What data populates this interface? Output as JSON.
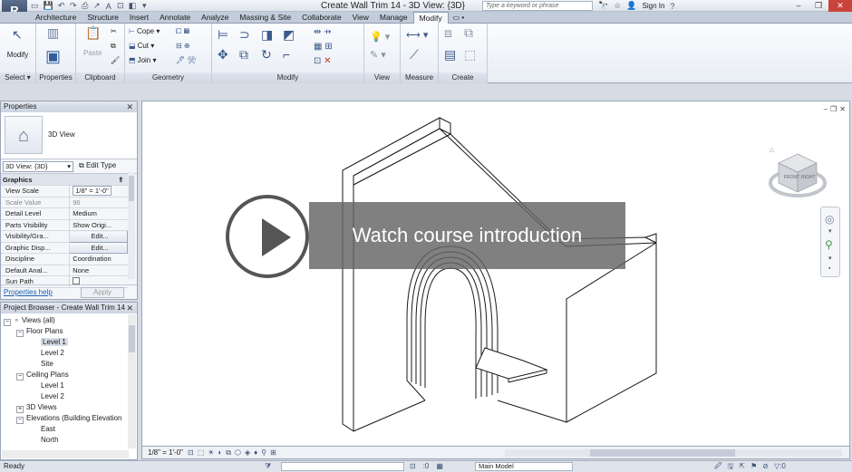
{
  "app": {
    "logo": "R",
    "quick_access": [
      "▭",
      "💾",
      "↶",
      "↷",
      "⎙",
      "↗",
      "A",
      "⊡",
      "◧",
      "▾"
    ],
    "title": "Create Wall Trim 14 - 3D View: {3D}",
    "search_placeholder": "Type a keyword or phrase",
    "title_icons": [
      "🔭",
      "☆",
      "👤"
    ],
    "sign_in": "Sign In",
    "help": "?",
    "window_buttons": [
      "–",
      "❐",
      "✕"
    ]
  },
  "ribbon": {
    "tabs": [
      "Architecture",
      "Structure",
      "Insert",
      "Annotate",
      "Analyze",
      "Massing & Site",
      "Collaborate",
      "View",
      "Manage",
      "Modify"
    ],
    "active_tab": "Modify",
    "tab_extra": "▭ •",
    "panels": {
      "select": {
        "label": "Select ▾",
        "button": "Modify"
      },
      "properties": {
        "label": "Properties"
      },
      "clipboard": {
        "label": "Clipboard",
        "button": "Paste"
      },
      "geometry": {
        "label": "Geometry",
        "cope": "Cope ▾",
        "cut": "Cut ▾",
        "join": "Join ▾"
      },
      "modify": {
        "label": "Modify"
      },
      "view": {
        "label": "View"
      },
      "measure": {
        "label": "Measure"
      },
      "create": {
        "label": "Create"
      }
    }
  },
  "properties": {
    "title": "Properties",
    "type_name": "3D View",
    "instance_select": "3D View: {3D}",
    "edit_type": "Edit Type",
    "group": "Graphics",
    "rows": [
      {
        "name": "View Scale",
        "value": "1/8\" = 1'-0\""
      },
      {
        "name": "Scale Value",
        "value": "96"
      },
      {
        "name": "Detail Level",
        "value": "Medium"
      },
      {
        "name": "Parts Visibility",
        "value": "Show Origi..."
      },
      {
        "name": "Visibility/Gra...",
        "value": "Edit..."
      },
      {
        "name": "Graphic Disp...",
        "value": "Edit..."
      },
      {
        "name": "Discipline",
        "value": "Coordination"
      },
      {
        "name": "Default Anal...",
        "value": "None"
      },
      {
        "name": "Sun Path",
        "value": ""
      }
    ],
    "help_link": "Properties help",
    "apply": "Apply"
  },
  "project_browser": {
    "title": "Project Browser - Create Wall Trim 14",
    "nodes": {
      "views": "Views (all)",
      "floor_plans": "Floor Plans",
      "level1": "Level 1",
      "level2": "Level 2",
      "site": "Site",
      "ceiling_plans": "Ceiling Plans",
      "c_level1": "Level 1",
      "c_level2": "Level 2",
      "views3d": "3D Views",
      "elevations": "Elevations (Building Elevation",
      "east": "East",
      "north": "North"
    }
  },
  "view": {
    "window_controls": [
      "–",
      "❐",
      "✕"
    ],
    "overlay_text": "Watch course introduction",
    "cube_labels": [
      "FRONT",
      "RIGHT"
    ],
    "scale": "1/8\" = 1'-0\"",
    "control_icons": [
      "⊡",
      "⬚",
      "☀",
      "◐",
      "⧉",
      "⬡",
      "◈",
      "♦",
      "⚲",
      "⊞"
    ]
  },
  "status": {
    "text": "Ready",
    "filter_icon": "⧩",
    "mid_icons": [
      "⊡",
      ":0",
      "▦"
    ],
    "model": "Main Model",
    "right_icons": [
      "🖉",
      "🖫",
      "⇱",
      "⚑",
      "⊘",
      "▽:0"
    ]
  }
}
